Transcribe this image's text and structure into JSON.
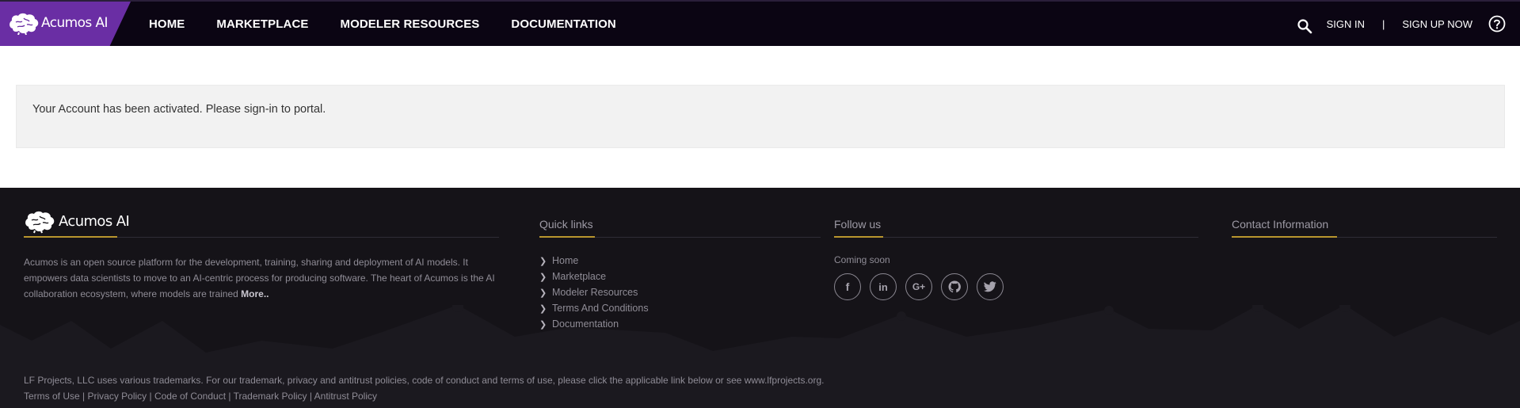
{
  "brand": {
    "name": "Acumos AI",
    "accent_color": "#6a2ea4",
    "icon": "brain-icon"
  },
  "nav": {
    "links": [
      "HOME",
      "MARKETPLACE",
      "MODELER RESOURCES",
      "DOCUMENTATION"
    ],
    "search_icon": "search-icon",
    "sign_in": "SIGN IN",
    "separator": "|",
    "sign_up": "SIGN UP NOW",
    "help_icon": "help-icon"
  },
  "main": {
    "alert_text": "Your Account has been activated. Please sign-in to portal."
  },
  "footer": {
    "logo_text": "Acumos AI",
    "about_text": "Acumos is an open source platform for the development, training, sharing and deployment of AI models. It empowers data scientists to move to an AI-centric process for producing software. The heart of Acumos is the AI collaboration ecosystem, where models are trained",
    "about_more": "More..",
    "quick_links_heading": "Quick links",
    "quick_links": [
      "Home",
      "Marketplace",
      "Modeler Resources",
      "Terms And Conditions",
      "Documentation"
    ],
    "follow_heading": "Follow us",
    "follow_status": "Coming soon",
    "social": [
      {
        "name": "facebook-icon",
        "glyph": "f"
      },
      {
        "name": "linkedin-icon",
        "glyph": "in"
      },
      {
        "name": "google-plus-icon",
        "glyph": "G+"
      },
      {
        "name": "github-icon",
        "glyph": ""
      },
      {
        "name": "twitter-icon",
        "glyph": ""
      }
    ],
    "contact_heading": "Contact Information",
    "trademark_text": "LF Projects, LLC uses various trademarks. For our trademark, privacy and antitrust policies, code of conduct and terms of use, please click the applicable link below or see www.lfprojects.org.",
    "policy_links": [
      "Terms of Use",
      "Privacy Policy",
      "Code of Conduct",
      "Trademark Policy",
      "Antitrust Policy"
    ],
    "policy_separator": " | ",
    "accent_color": "#b8962e"
  }
}
